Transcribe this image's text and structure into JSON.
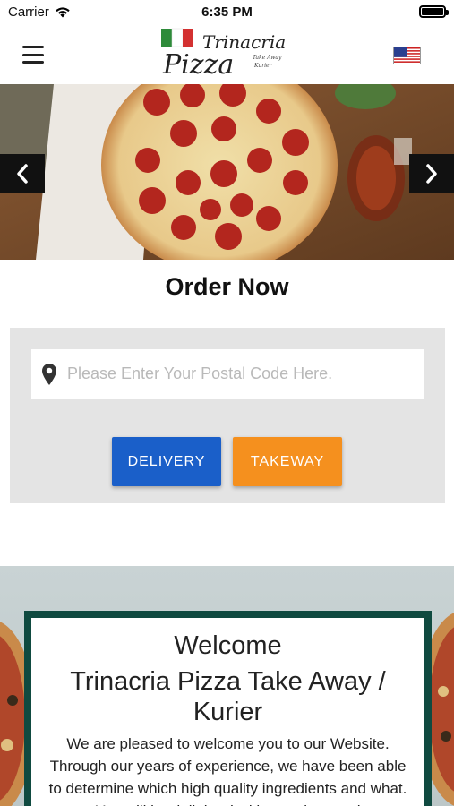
{
  "status_bar": {
    "carrier": "Carrier",
    "time": "6:35 PM"
  },
  "header": {
    "logo_text_main": "Trinacria",
    "logo_text_sub": "Pizza",
    "logo_text_small_1": "Take Away",
    "logo_text_small_2": "Kurier",
    "menu_icon": "hamburger-icon",
    "language_flag": "us-flag-icon"
  },
  "hero": {
    "prev_icon": "chevron-left-icon",
    "next_icon": "chevron-right-icon"
  },
  "order": {
    "title": "Order Now",
    "postal_placeholder": "Please Enter Your Postal Code Here.",
    "postal_value": "",
    "delivery_label": "DELIVERY",
    "takeaway_label": "TAKEWAY"
  },
  "welcome": {
    "line1": "Welcome",
    "line2": "Trinacria Pizza Take Away / Kurier",
    "body": "We are pleased to welcome you to our Website. Through our years of experience, we have been able to determine which high quality ingredients and what. You will be delighted with our pizza and"
  },
  "colors": {
    "delivery": "#1a5fc9",
    "takeaway": "#f5901e",
    "panel": "#e4e4e4",
    "frame": "#0f4a40"
  }
}
